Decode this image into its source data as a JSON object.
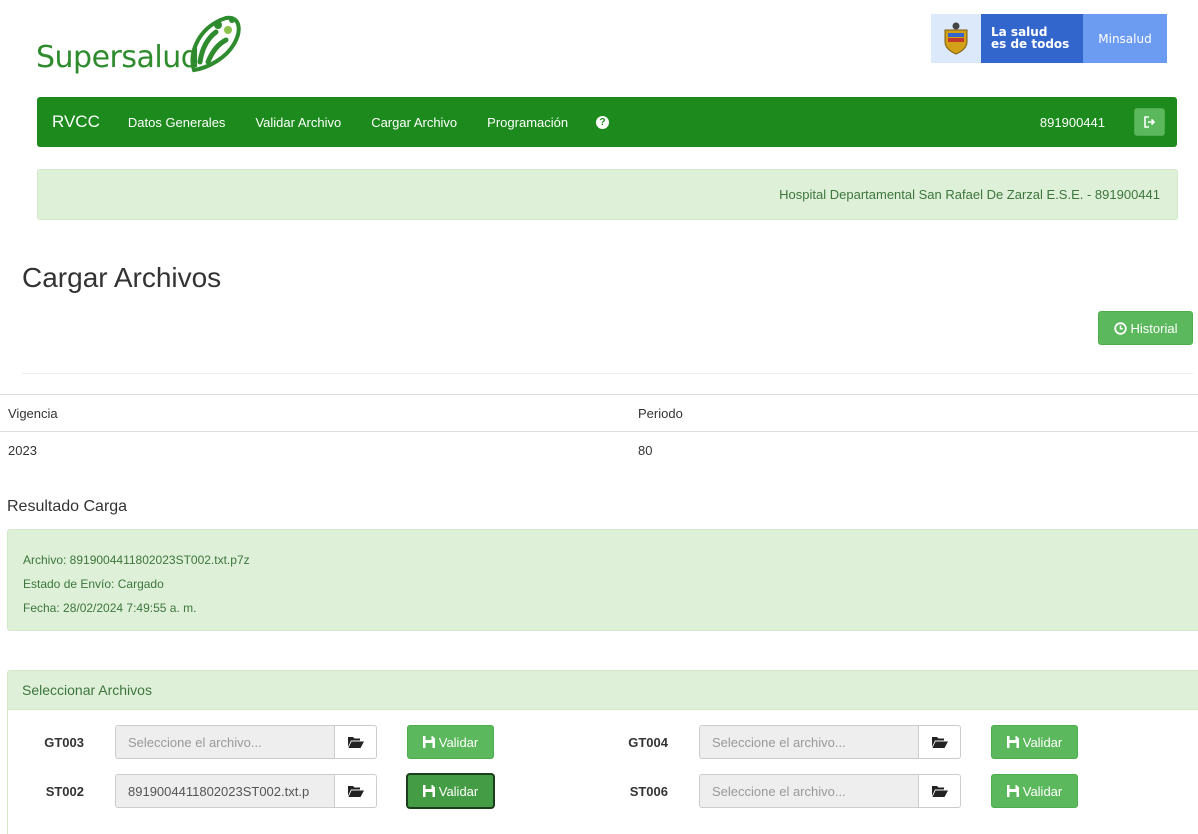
{
  "logo": {
    "text": "Supersalud"
  },
  "gov_banner": {
    "line1": "La salud",
    "line2": "es de todos",
    "right": "Minsalud"
  },
  "navbar": {
    "brand": "RVCC",
    "items": [
      {
        "label": "Datos Generales"
      },
      {
        "label": "Validar Archivo"
      },
      {
        "label": "Cargar Archivo"
      },
      {
        "label": "Programación"
      }
    ],
    "help_symbol": "?",
    "user_id": "891900441"
  },
  "info_bar": {
    "text": "Hospital Departamental San Rafael De Zarzal E.S.E. - 891900441"
  },
  "page_title": "Cargar Archivos",
  "historial_button": "Historial",
  "table": {
    "headers": [
      "Vigencia",
      "Periodo"
    ],
    "rows": [
      [
        "2023",
        "80"
      ]
    ]
  },
  "resultado": {
    "title": "Resultado Carga",
    "archivo": "Archivo: 8919004411802023ST002.txt.p7z",
    "estado": "Estado de Envío: Cargado",
    "fecha": "Fecha: 28/02/2024 7:49:55 a. m."
  },
  "panel": {
    "title": "Seleccionar Archivos",
    "validar_label": "Validar",
    "files": [
      {
        "code": "GT003",
        "value": "",
        "placeholder": "Seleccione el archivo..."
      },
      {
        "code": "GT004",
        "value": "",
        "placeholder": "Seleccione el archivo..."
      },
      {
        "code": "ST002",
        "value": "8919004411802023ST002.txt.p",
        "placeholder": "Seleccione el archivo..."
      },
      {
        "code": "ST006",
        "value": "",
        "placeholder": "Seleccione el archivo..."
      }
    ]
  },
  "colors": {
    "navbar": "#1c8a1c",
    "button": "#5cb85c",
    "success_bg": "#dff0d8",
    "success_text": "#3c763d",
    "gov_blue": "#3366cc"
  }
}
